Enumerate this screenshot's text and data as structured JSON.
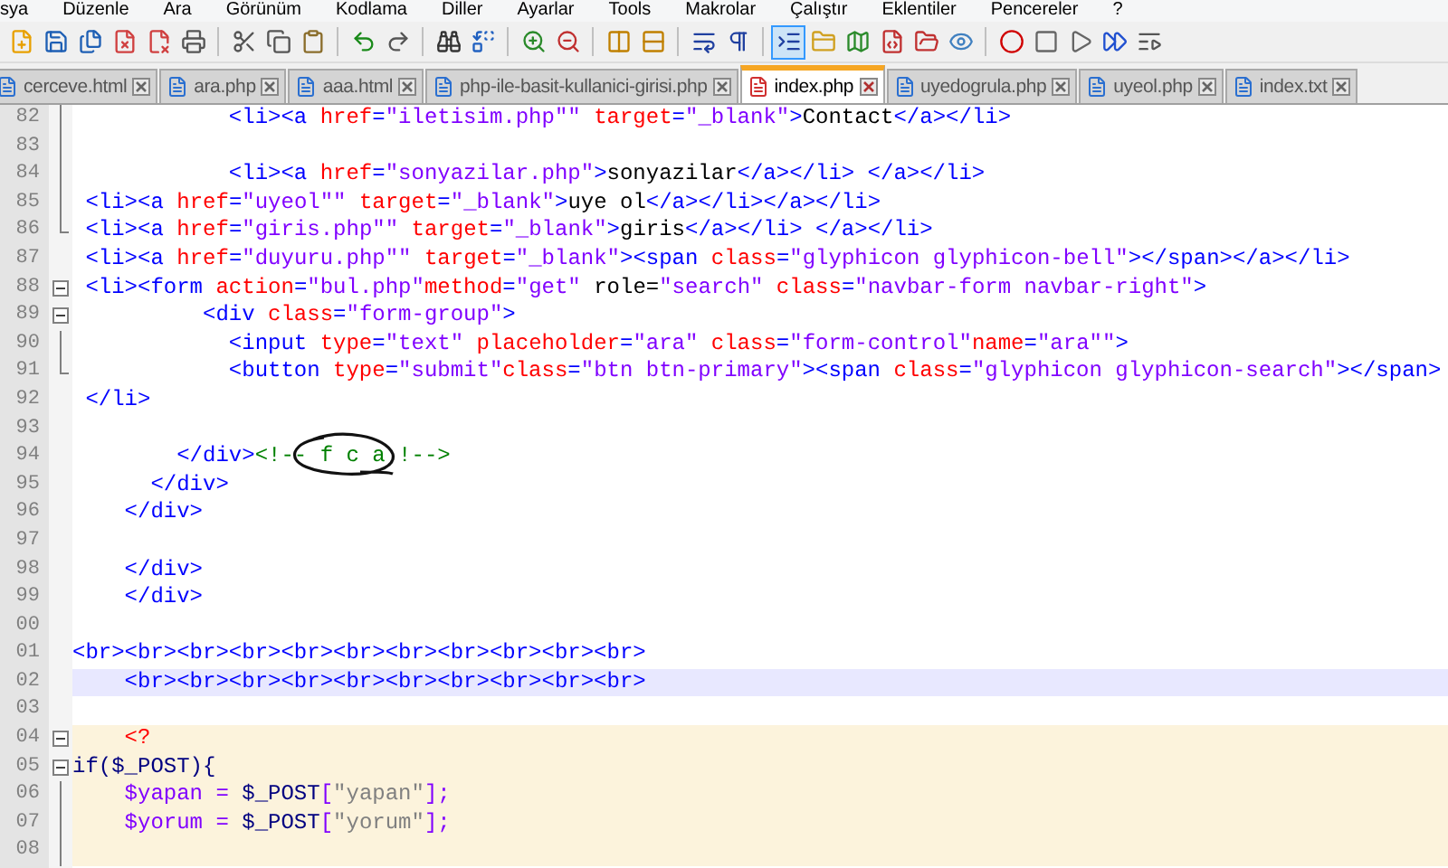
{
  "menu": [
    "sya",
    "Düzenle",
    "Ara",
    "Görünüm",
    "Kodlama",
    "Diller",
    "Ayarlar",
    "Tools",
    "Makrolar",
    "Çalıştır",
    "Eklentiler",
    "Pencereler",
    "?"
  ],
  "toolbar": [
    {
      "selected": false
    },
    {
      "selected": false
    },
    {
      "selected": false
    },
    {
      "selected": false
    },
    {
      "selected": false
    },
    {
      "selected": false
    },
    {
      "selected": false
    },
    {
      "selected": false
    },
    {
      "selected": false
    },
    {
      "selected": false
    },
    {
      "selected": false
    },
    {
      "selected": false
    },
    {
      "selected": false
    },
    {
      "selected": false
    },
    {
      "selected": false
    },
    {
      "selected": false
    },
    {
      "selected": false
    },
    {
      "selected": false
    },
    {
      "selected": false
    },
    {
      "selected": true
    },
    {
      "selected": false
    },
    {
      "selected": false
    },
    {
      "selected": false
    },
    {
      "selected": false
    },
    {
      "selected": false
    },
    {
      "selected": false
    },
    {
      "selected": false
    },
    {
      "selected": false
    },
    {
      "selected": false
    },
    {
      "selected": false
    }
  ],
  "tabs": [
    {
      "label": "cerceve.html",
      "selected": false
    },
    {
      "label": "ara.php",
      "selected": false
    },
    {
      "label": "aaa.html",
      "selected": false
    },
    {
      "label": "php-ile-basit-kullanici-girisi.php",
      "selected": false
    },
    {
      "label": "index.php",
      "selected": true
    },
    {
      "label": "uyedogrula.php",
      "selected": false
    },
    {
      "label": "uyeol.php",
      "selected": false
    },
    {
      "label": "index.txt",
      "selected": false
    }
  ],
  "editor": {
    "lines": [
      {
        "number": "82",
        "fold_guide": true,
        "tokens": [
          {
            "kind": "tag",
            "text": "            <li><a"
          },
          {
            "kind": "attr",
            "text": " href"
          },
          {
            "kind": "tag",
            "text": "="
          },
          {
            "kind": "string",
            "text": "\"iletisim.php\"\""
          },
          {
            "kind": "attr",
            "text": " target"
          },
          {
            "kind": "tag",
            "text": "="
          },
          {
            "kind": "string",
            "text": "\"_blank\""
          },
          {
            "kind": "tag",
            "text": ">"
          },
          {
            "kind": "text",
            "text": "Contact"
          },
          {
            "kind": "tag",
            "text": "</a></li>"
          }
        ]
      },
      {
        "number": "83",
        "fold_guide": true
      },
      {
        "number": "84",
        "fold_guide": true,
        "tokens": [
          {
            "kind": "tag",
            "text": "            <li><a"
          },
          {
            "kind": "attr",
            "text": " href"
          },
          {
            "kind": "tag",
            "text": "="
          },
          {
            "kind": "string",
            "text": "\"sonyazilar.php\""
          },
          {
            "kind": "tag",
            "text": ">"
          },
          {
            "kind": "text",
            "text": "sonyazilar"
          },
          {
            "kind": "tag",
            "text": "</a></li> </a></li>"
          }
        ]
      },
      {
        "number": "85",
        "fold_guide": true,
        "tokens": [
          {
            "kind": "tag",
            "text": " <li><a"
          },
          {
            "kind": "attr",
            "text": " href"
          },
          {
            "kind": "tag",
            "text": "="
          },
          {
            "kind": "string",
            "text": "\"uyeol\"\""
          },
          {
            "kind": "attr",
            "text": " target"
          },
          {
            "kind": "tag",
            "text": "="
          },
          {
            "kind": "string",
            "text": "\"_blank\""
          },
          {
            "kind": "tag",
            "text": ">"
          },
          {
            "kind": "text",
            "text": "uye ol"
          },
          {
            "kind": "tag",
            "text": "</a></li></a></li>"
          }
        ]
      },
      {
        "number": "86",
        "fold_end": true,
        "tokens": [
          {
            "kind": "tag",
            "text": " <li><a"
          },
          {
            "kind": "attr",
            "text": " href"
          },
          {
            "kind": "tag",
            "text": "="
          },
          {
            "kind": "string",
            "text": "\"giris.php\"\""
          },
          {
            "kind": "attr",
            "text": " target"
          },
          {
            "kind": "tag",
            "text": "="
          },
          {
            "kind": "string",
            "text": "\"_blank\""
          },
          {
            "kind": "tag",
            "text": ">"
          },
          {
            "kind": "text",
            "text": "giris"
          },
          {
            "kind": "tag",
            "text": "</a></li> </a></li>"
          }
        ]
      },
      {
        "number": "87",
        "tokens": [
          {
            "kind": "tag",
            "text": " <li><a"
          },
          {
            "kind": "attr",
            "text": " href"
          },
          {
            "kind": "tag",
            "text": "="
          },
          {
            "kind": "string",
            "text": "\"duyuru.php\"\""
          },
          {
            "kind": "attr",
            "text": " target"
          },
          {
            "kind": "tag",
            "text": "="
          },
          {
            "kind": "string",
            "text": "\"_blank\""
          },
          {
            "kind": "tag",
            "text": "><span"
          },
          {
            "kind": "attr",
            "text": " class"
          },
          {
            "kind": "tag",
            "text": "="
          },
          {
            "kind": "string",
            "text": "\"glyphicon glyphicon-bell\""
          },
          {
            "kind": "tag",
            "text": "></span></a></li>"
          }
        ]
      },
      {
        "number": "88",
        "fold_open": true,
        "tokens": [
          {
            "kind": "tag",
            "text": " <li><form"
          },
          {
            "kind": "attr",
            "text": " action"
          },
          {
            "kind": "tag",
            "text": "="
          },
          {
            "kind": "string",
            "text": "\"bul.php\""
          },
          {
            "kind": "attr",
            "text": "method"
          },
          {
            "kind": "tag",
            "text": "="
          },
          {
            "kind": "string",
            "text": "\"get\""
          },
          {
            "kind": "text",
            "text": " role="
          },
          {
            "kind": "string",
            "text": "\"search\""
          },
          {
            "kind": "attr",
            "text": " class"
          },
          {
            "kind": "tag",
            "text": "="
          },
          {
            "kind": "string",
            "text": "\"navbar-form navbar-right\""
          },
          {
            "kind": "tag",
            "text": ">"
          }
        ]
      },
      {
        "number": "89",
        "fold_open": true,
        "tokens": [
          {
            "kind": "tag",
            "text": "          <div"
          },
          {
            "kind": "attr",
            "text": " class"
          },
          {
            "kind": "tag",
            "text": "="
          },
          {
            "kind": "string",
            "text": "\"form-group\""
          },
          {
            "kind": "tag",
            "text": ">"
          }
        ]
      },
      {
        "number": "90",
        "fold_guide": true,
        "tokens": [
          {
            "kind": "tag",
            "text": "            <input"
          },
          {
            "kind": "attr",
            "text": " type"
          },
          {
            "kind": "tag",
            "text": "="
          },
          {
            "kind": "string",
            "text": "\"text\""
          },
          {
            "kind": "attr",
            "text": " placeholder"
          },
          {
            "kind": "tag",
            "text": "="
          },
          {
            "kind": "string",
            "text": "\"ara\""
          },
          {
            "kind": "attr",
            "text": " class"
          },
          {
            "kind": "tag",
            "text": "="
          },
          {
            "kind": "string",
            "text": "\"form-control\""
          },
          {
            "kind": "attr",
            "text": "name"
          },
          {
            "kind": "tag",
            "text": "="
          },
          {
            "kind": "string",
            "text": "\"ara\"\""
          },
          {
            "kind": "tag",
            "text": ">"
          }
        ]
      },
      {
        "number": "91",
        "fold_end": true,
        "tokens": [
          {
            "kind": "tag",
            "text": "            <button"
          },
          {
            "kind": "attr",
            "text": " type"
          },
          {
            "kind": "tag",
            "text": "="
          },
          {
            "kind": "string",
            "text": "\"submit\""
          },
          {
            "kind": "attr",
            "text": "class"
          },
          {
            "kind": "tag",
            "text": "="
          },
          {
            "kind": "string",
            "text": "\"btn btn-primary\""
          },
          {
            "kind": "tag",
            "text": "><span"
          },
          {
            "kind": "attr",
            "text": " class"
          },
          {
            "kind": "tag",
            "text": "="
          },
          {
            "kind": "string",
            "text": "\"glyphicon glyphicon-search\""
          },
          {
            "kind": "tag",
            "text": "></span>"
          }
        ]
      },
      {
        "number": "92",
        "tokens": [
          {
            "kind": "tag",
            "text": " </li>"
          }
        ]
      },
      {
        "number": "93"
      },
      {
        "number": "94",
        "tokens": [
          {
            "kind": "tag",
            "text": "        </div>"
          },
          {
            "kind": "comment",
            "text": "<!-- f c a !-->"
          }
        ]
      },
      {
        "number": "95",
        "tokens": [
          {
            "kind": "tag",
            "text": "      </div>"
          }
        ]
      },
      {
        "number": "96",
        "tokens": [
          {
            "kind": "tag",
            "text": "    </div>"
          }
        ]
      },
      {
        "number": "97"
      },
      {
        "number": "98",
        "tokens": [
          {
            "kind": "tag",
            "text": "    </div>"
          }
        ]
      },
      {
        "number": "99",
        "tokens": [
          {
            "kind": "tag",
            "text": "    </div>"
          }
        ]
      },
      {
        "number": "00"
      },
      {
        "number": "01",
        "tokens": [
          {
            "kind": "tag",
            "text": "<br><br><br><br><br><br><br><br><br><br><br>"
          }
        ]
      },
      {
        "number": "02",
        "current": true,
        "tokens": [
          {
            "kind": "tag",
            "text": "    <br><br><br><br><br><br><br><br><br><br>"
          }
        ]
      },
      {
        "number": "03"
      },
      {
        "number": "04",
        "fold_open": true,
        "php": true,
        "tokens": [
          {
            "kind": "php",
            "text": "    <?"
          }
        ]
      },
      {
        "number": "05",
        "fold_open": true,
        "php": true,
        "tokens": [
          {
            "kind": "keyword",
            "text": "if($_POST){"
          }
        ]
      },
      {
        "number": "06",
        "fold_guide": true,
        "php": true,
        "tokens": [
          {
            "kind": "var",
            "text": "    $yapan"
          },
          {
            "kind": "op",
            "text": " = "
          },
          {
            "kind": "keyword",
            "text": "$_POST"
          },
          {
            "kind": "op",
            "text": "["
          },
          {
            "kind": "phpstring",
            "text": "\"yapan\""
          },
          {
            "kind": "op",
            "text": "];"
          }
        ]
      },
      {
        "number": "07",
        "fold_guide": true,
        "php": true,
        "tokens": [
          {
            "kind": "var",
            "text": "    $yorum"
          },
          {
            "kind": "op",
            "text": " = "
          },
          {
            "kind": "keyword",
            "text": "$_POST"
          },
          {
            "kind": "op",
            "text": "["
          },
          {
            "kind": "phpstring",
            "text": "\"yorum\""
          },
          {
            "kind": "op",
            "text": "];"
          }
        ]
      },
      {
        "number": "08",
        "fold_guide": true,
        "php": true
      }
    ]
  }
}
